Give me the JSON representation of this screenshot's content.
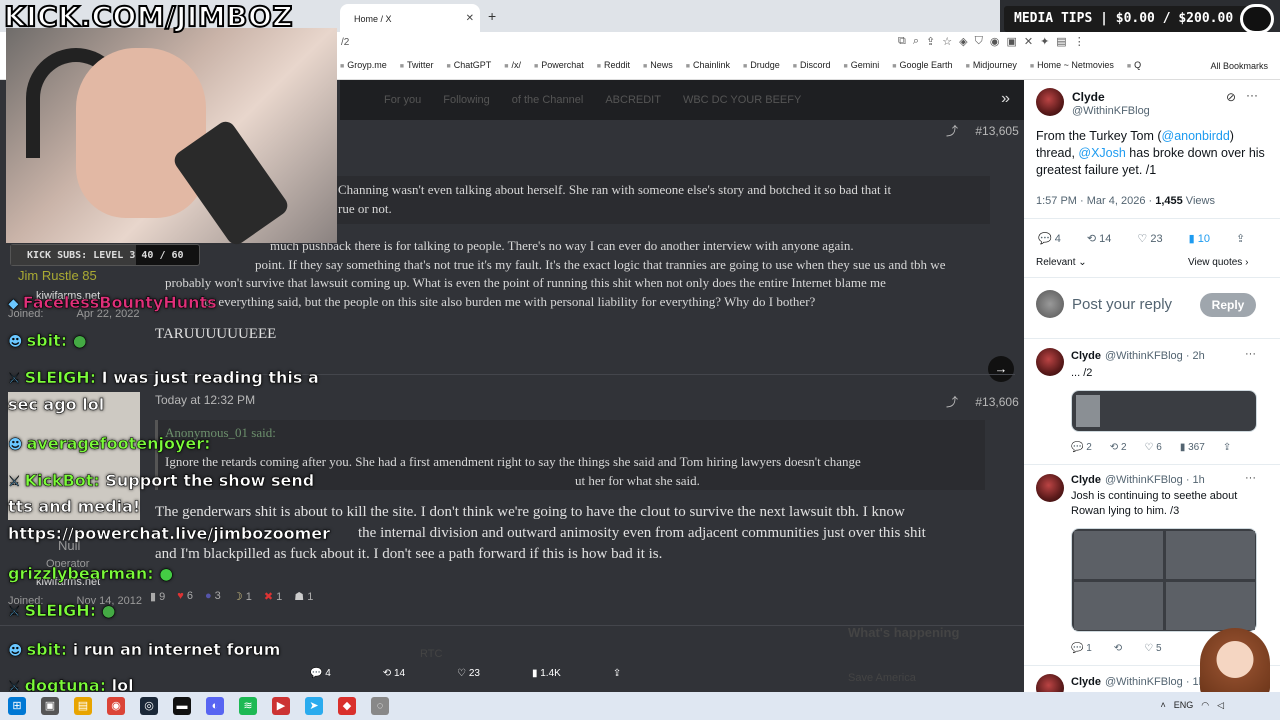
{
  "browser": {
    "tab_title": "Home / X",
    "url_fragment": "/2",
    "bookmarks": [
      "Groyp.me",
      "Twitter",
      "ChatGPT",
      "/x/",
      "Powerchat",
      "Reddit",
      "News",
      "Chainlink",
      "Drudge",
      "Discord",
      "Gemini",
      "Google Earth",
      "Midjourney",
      "Home ~ Netmovies",
      "Q"
    ],
    "all_bookmarks": "All Bookmarks"
  },
  "stream": {
    "channel_title": "KICK.COM/JIMBOZ",
    "subs_label": "KICK SUBS: LEVEL 3",
    "subs_count": "40 / 60",
    "subs_progress": 0.667,
    "media_tips": "MEDIA TIPS | $0.00 / $200.00"
  },
  "chat": [
    {
      "user": "FacelessBountyHunts",
      "message": ""
    },
    {
      "user": "sbit:",
      "message": ""
    },
    {
      "user": "SLEIGH:",
      "message": "I was just reading this a"
    },
    {
      "user": "",
      "message": "sec ago lol"
    },
    {
      "user": "averagefootenjoyer:",
      "message": ""
    },
    {
      "user": "KickBot:",
      "message": "Support the show send"
    },
    {
      "user": "",
      "message": "tts and media!"
    },
    {
      "user": "",
      "message": "https://powerchat.live/jimbozoomer"
    },
    {
      "user": "grizzlybearman:",
      "message": ""
    },
    {
      "user": "SLEIGH:",
      "message": ""
    },
    {
      "user": "sbit:",
      "message": "i run an internet forum"
    },
    {
      "user": "dogtuna:",
      "message": "lol"
    }
  ],
  "forum": {
    "nav_items": [
      "For you",
      "Following",
      "of the Channel",
      "ABCREDIT",
      "WBC DC YOUR BEEFY"
    ],
    "profile_bits": {
      "name": "Jim Rustle 85",
      "site": "kiwifarms.net",
      "joined_label": "Joined:",
      "joined_date": "Apr 22, 2022",
      "role": "Operator",
      "site2": "kiwifarms.net",
      "null_name": "Null",
      "joined_date2": "Nov 14, 2012"
    },
    "post1": {
      "number": "#13,605",
      "quote_lines": [
        "Channing wasn't even talking about herself. She ran with someone else's story and botched it so bad that it",
        "rue or not."
      ],
      "body_lines": [
        "much pushback there is for talking to people. There's no way I can ever do another interview with anyone again.",
        "point. If they say something that's not true it's my fault. It's the exact logic that trannies are going to use when they sue us and tbh we",
        "probably won't survive that lawsuit coming up. What is even the point of running this shit when not only does the entire Internet blame me",
        "for everything said, but the people on this site also burden me with personal liability for everything? Why do I bother?"
      ],
      "reply": "TARUUUUUUEEE"
    },
    "post2": {
      "timestamp": "Today at 12:32 PM",
      "number": "#13,606",
      "quote_author": "Anonymous_01 said:",
      "quote_lines": [
        "Ignore the retards coming after you. She had a first amendment right to say the things she said and Tom hiring lawyers doesn't change",
        "ut her for what she said."
      ],
      "body_lines": [
        "The genderwars shit is about to kill the site. I don't think we're going to have the clout to survive the next lawsuit tbh. I know",
        "the internal division and outward animosity even from adjacent communities just over this shit",
        "and I'm blackpilled as fuck about it. I don't see a path forward if this is how bad it is."
      ],
      "reactions": [
        "9",
        "6",
        "3",
        "1",
        "1",
        "1"
      ]
    },
    "whats_happening": "What's happening",
    "rtc_fragment": "RTC",
    "save_america": "Save America"
  },
  "tweet_actions": {
    "replies": "4",
    "reposts": "14",
    "likes": "23",
    "views": "1.4K"
  },
  "twitter": {
    "main": {
      "name": "Clyde",
      "handle": "@WithinKFBlog",
      "text_pre": "From the Turkey Tom (",
      "mention1": "@anonbirdd",
      "text_mid": ") thread, ",
      "mention2": "@XJosh",
      "text_post": " has broke down over his greatest failure yet. /1",
      "time": "1:57 PM · Mar 4, 2026 · ",
      "views": "1,455",
      "views_label": " Views",
      "replies": "4",
      "reposts": "14",
      "likes": "23",
      "bookmarks": "10",
      "relevant": "Relevant",
      "view_quotes": "View quotes"
    },
    "reply_box": {
      "placeholder": "Post your reply",
      "button": "Reply"
    },
    "thread": [
      {
        "name": "Clyde",
        "handle": "@WithinKFBlog · 2h",
        "text": "... /2",
        "replies": "2",
        "reposts": "2",
        "likes": "6",
        "views": "367"
      },
      {
        "name": "Clyde",
        "handle": "@WithinKFBlog · 1h",
        "text": "Josh is continuing to seethe about Rowan lying to him. /3",
        "replies": "1",
        "reposts": "",
        "likes": "5",
        "views": ""
      },
      {
        "name": "Clyde",
        "handle": "@WithinKFBlog · 1h",
        "text": "",
        "replies": "",
        "reposts": "",
        "likes": "",
        "views": ""
      }
    ]
  },
  "taskbar": {
    "lang": "ENG"
  }
}
